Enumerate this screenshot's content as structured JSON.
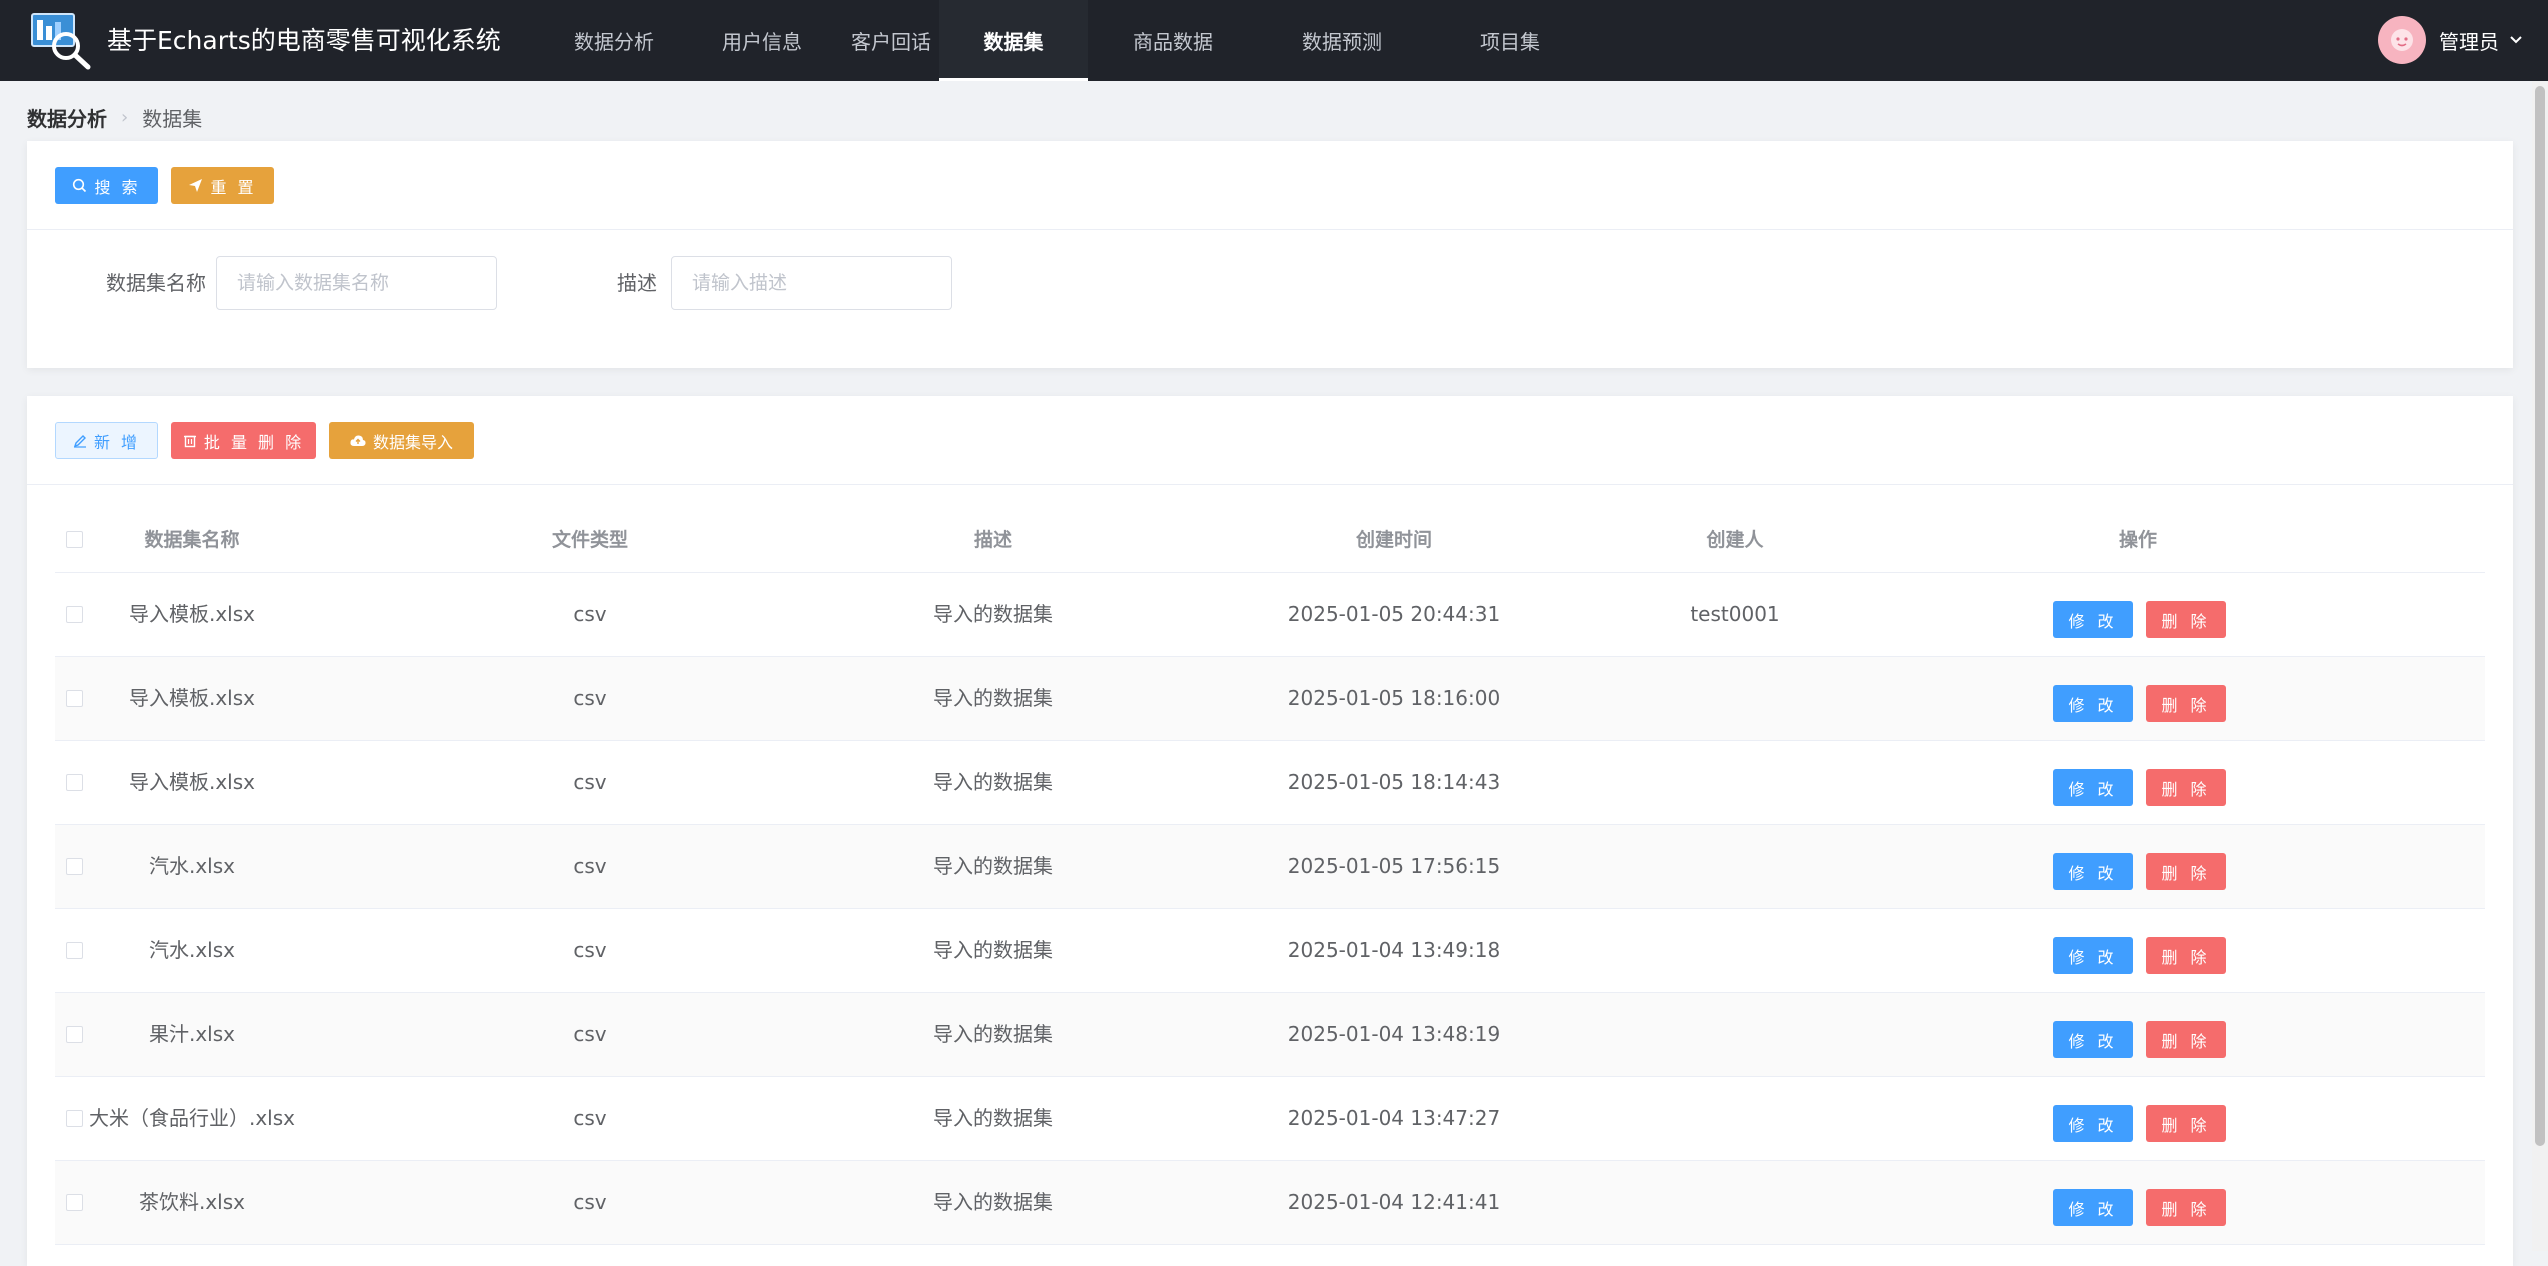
{
  "header": {
    "app_title": "基于Echarts的电商零售可视化系统",
    "nav": [
      "数据分析",
      "用户信息",
      "客户回话",
      "数据集",
      "商品数据",
      "数据预测",
      "项目集"
    ],
    "active_nav": "数据集",
    "user_name": "管理员"
  },
  "breadcrumb": {
    "root": "数据分析",
    "current": "数据集"
  },
  "search_panel": {
    "search_label": "搜 索",
    "reset_label": "重 置",
    "name_label": "数据集名称",
    "name_placeholder": "请输入数据集名称",
    "name_value": "",
    "desc_label": "描述",
    "desc_placeholder": "请输入描述",
    "desc_value": ""
  },
  "actions": {
    "add_label": "新 增",
    "batch_delete_label": "批 量 删 除",
    "import_label": "数据集导入"
  },
  "table": {
    "columns": [
      "数据集名称",
      "文件类型",
      "描述",
      "创建时间",
      "创建人",
      "操作"
    ],
    "edit_label": "修 改",
    "delete_label": "删 除",
    "rows": [
      {
        "name": "导入模板.xlsx",
        "type": "csv",
        "desc": "导入的数据集",
        "created": "2025-01-05 20:44:31",
        "creator": "test0001"
      },
      {
        "name": "导入模板.xlsx",
        "type": "csv",
        "desc": "导入的数据集",
        "created": "2025-01-05 18:16:00",
        "creator": ""
      },
      {
        "name": "导入模板.xlsx",
        "type": "csv",
        "desc": "导入的数据集",
        "created": "2025-01-05 18:14:43",
        "creator": ""
      },
      {
        "name": "汽水.xlsx",
        "type": "csv",
        "desc": "导入的数据集",
        "created": "2025-01-05 17:56:15",
        "creator": ""
      },
      {
        "name": "汽水.xlsx",
        "type": "csv",
        "desc": "导入的数据集",
        "created": "2025-01-04 13:49:18",
        "creator": ""
      },
      {
        "name": "果汁.xlsx",
        "type": "csv",
        "desc": "导入的数据集",
        "created": "2025-01-04 13:48:19",
        "creator": ""
      },
      {
        "name": "大米（食品行业）.xlsx",
        "type": "csv",
        "desc": "导入的数据集",
        "created": "2025-01-04 13:47:27",
        "creator": ""
      },
      {
        "name": "茶饮料.xlsx",
        "type": "csv",
        "desc": "导入的数据集",
        "created": "2025-01-04 12:41:41",
        "creator": ""
      }
    ]
  },
  "colors": {
    "header_bg": "#20232a",
    "primary": "#409eff",
    "warning": "#e6a23c",
    "danger": "#f56c6c"
  }
}
